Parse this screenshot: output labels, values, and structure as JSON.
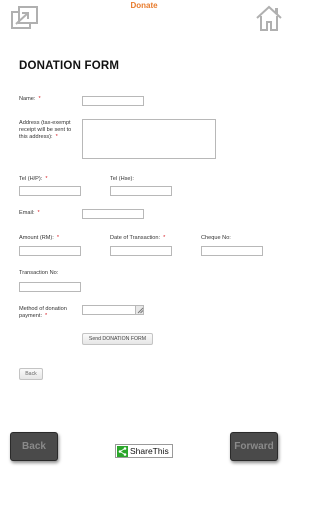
{
  "header": {
    "title": "Donate",
    "external_icon": "external-link-icon",
    "home_icon": "home-icon"
  },
  "form": {
    "title": "DONATION FORM",
    "name_label": "Name:",
    "address_label": "Address (tax-exempt receipt will be sent to this address):",
    "tel_hp_label": "Tel (H/P):",
    "tel_hse_label": "Tel (Hse):",
    "email_label": "Email:",
    "amount_label": "Amount (RM):",
    "date_label": "Date of Transaction:",
    "cheque_label": "Cheque No:",
    "transaction_label": "Transaction No:",
    "method_label": "Method of donation payment:",
    "required_mark": "*",
    "send_label": "Send DONATION FORM",
    "back_label": "Back"
  },
  "nav": {
    "back_label": "Back",
    "forward_label": "Forward",
    "share_label": "ShareThis"
  },
  "colors": {
    "accent": "#e87b2c",
    "required": "#d8232a",
    "share_green": "#2aa62a",
    "nav_button": "#4a4a4a"
  }
}
